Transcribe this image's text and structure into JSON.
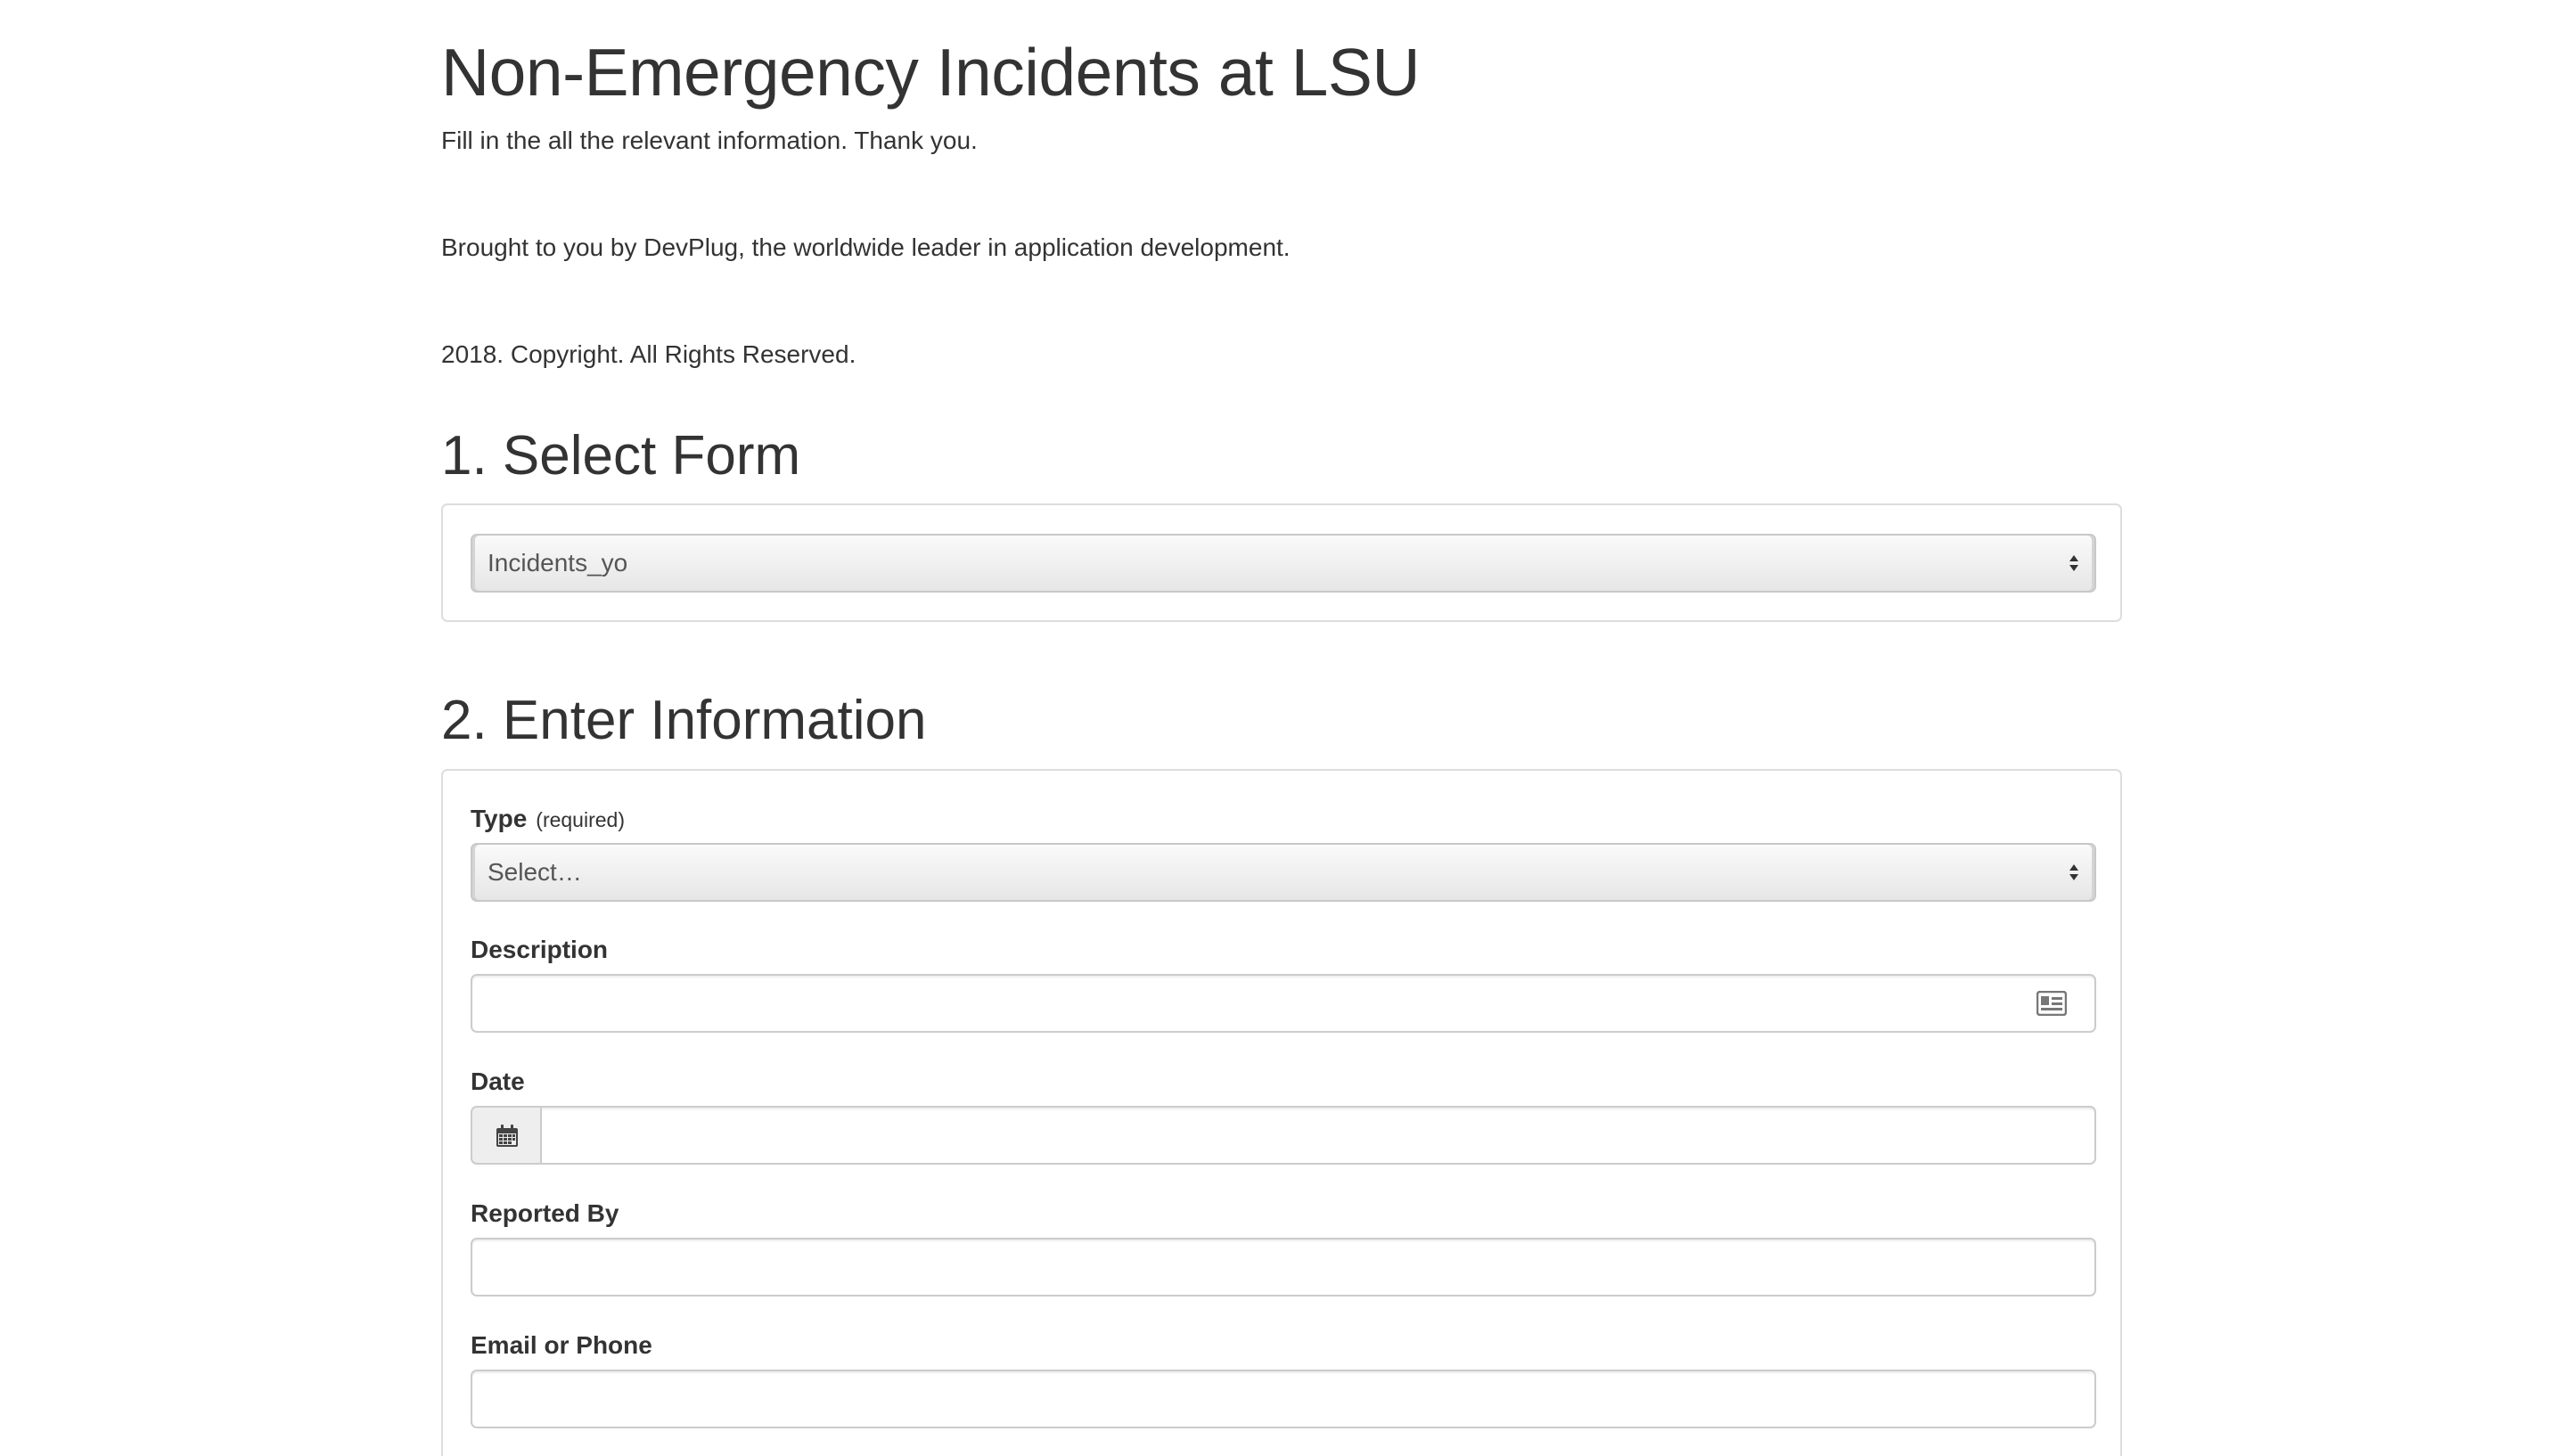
{
  "header": {
    "title": "Non-Emergency Incidents at LSU",
    "subtitle": "Fill in the all the relevant information. Thank you.",
    "credit": "Brought to you by DevPlug, the worldwide leader in application development.",
    "copyright": "2018. Copyright. All Rights Reserved."
  },
  "select_form": {
    "heading": "1. Select Form",
    "selected": "Incidents_yo",
    "icon": "select-arrows-icon"
  },
  "enter_info": {
    "heading": "2. Enter Information",
    "type": {
      "label": "Type",
      "required_text": "(required)",
      "selected": "Select…"
    },
    "description": {
      "label": "Description",
      "value": "",
      "icon": "id-card-icon"
    },
    "date": {
      "label": "Date",
      "value": "",
      "icon": "calendar-icon"
    },
    "reported_by": {
      "label": "Reported By",
      "value": ""
    },
    "email_or_phone": {
      "label": "Email or Phone",
      "value": ""
    }
  }
}
